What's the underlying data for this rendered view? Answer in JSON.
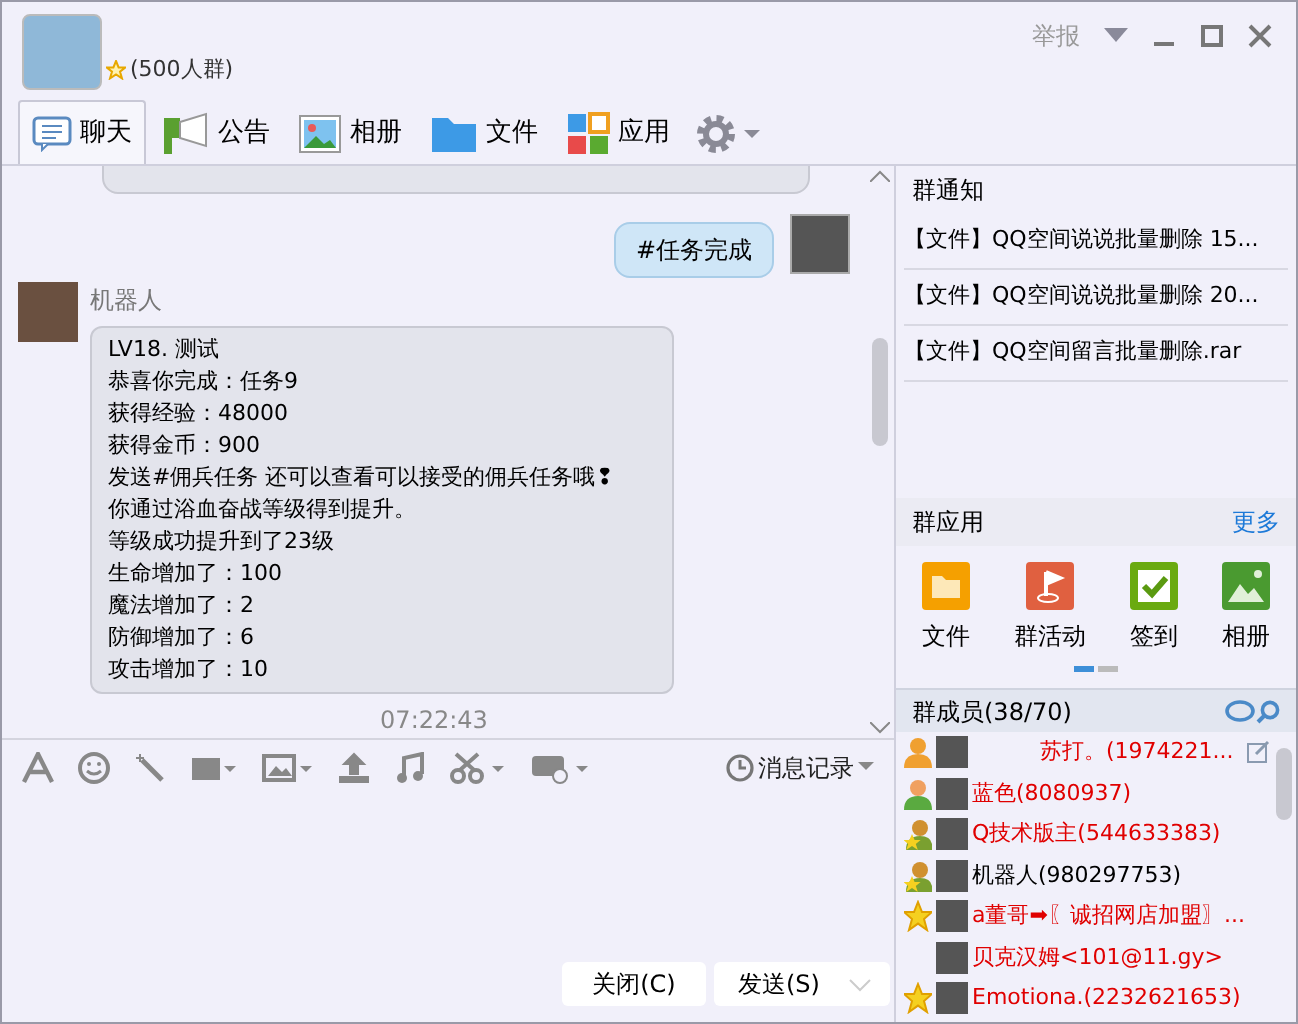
{
  "header": {
    "group_size": "(500人群)",
    "report": "举报"
  },
  "tabs": [
    {
      "label": "聊天",
      "selected": true
    },
    {
      "label": "公告",
      "selected": false
    },
    {
      "label": "相册",
      "selected": false
    },
    {
      "label": "文件",
      "selected": false
    },
    {
      "label": "应用",
      "selected": false
    }
  ],
  "messages": [
    {
      "kind": "self",
      "text": "#任务完成"
    },
    {
      "kind": "other",
      "sender": "机器人",
      "lines": [
        "LV18. 测试",
        "恭喜你完成：任务9",
        "获得经验：48000",
        "获得金币：900",
        "发送#佣兵任务 还可以查看可以接受的佣兵任务哦❢",
        "你通过浴血奋战等级得到提升。",
        "等级成功提升到了23级",
        "生命增加了：100",
        "魔法增加了：2",
        "防御增加了：6",
        "攻击增加了：10"
      ]
    },
    {
      "kind": "time",
      "text": "07:22:43"
    }
  ],
  "history_button": "消息记录",
  "buttons": [
    {
      "label": "关闭(C)"
    },
    {
      "label": "发送(S)"
    }
  ],
  "notices": {
    "title": "群通知",
    "items": [
      "【文件】QQ空间说说批量删除 15...",
      "【文件】QQ空间说说批量删除 20...",
      "【文件】QQ空间留言批量删除.rar"
    ]
  },
  "apps": {
    "title": "群应用",
    "more": "更多",
    "items": [
      {
        "label": "文件"
      },
      {
        "label": "群活动"
      },
      {
        "label": "签到"
      },
      {
        "label": "相册"
      }
    ]
  },
  "members": {
    "title": "群成员(38/70)",
    "items": [
      {
        "name": "苏打。(1974221...",
        "kind": "owner",
        "color": "#e00000"
      },
      {
        "name": "蓝色(8080937)",
        "kind": "member",
        "color": "#e00000"
      },
      {
        "name": "Q技术版主(544633383)",
        "kind": "admin",
        "color": "#e00000"
      },
      {
        "name": "机器人(980297753)",
        "kind": "admin",
        "color": "#000000"
      },
      {
        "name": "a董哥➡〖诚招网店加盟〗...",
        "kind": "vip",
        "color": "#e00000"
      },
      {
        "name": "贝克汉姆<101@11.gy>",
        "kind": "plain",
        "color": "#e00000"
      },
      {
        "name": "Emotiona.(2232621653)",
        "kind": "vip",
        "color": "#e00000"
      }
    ]
  }
}
